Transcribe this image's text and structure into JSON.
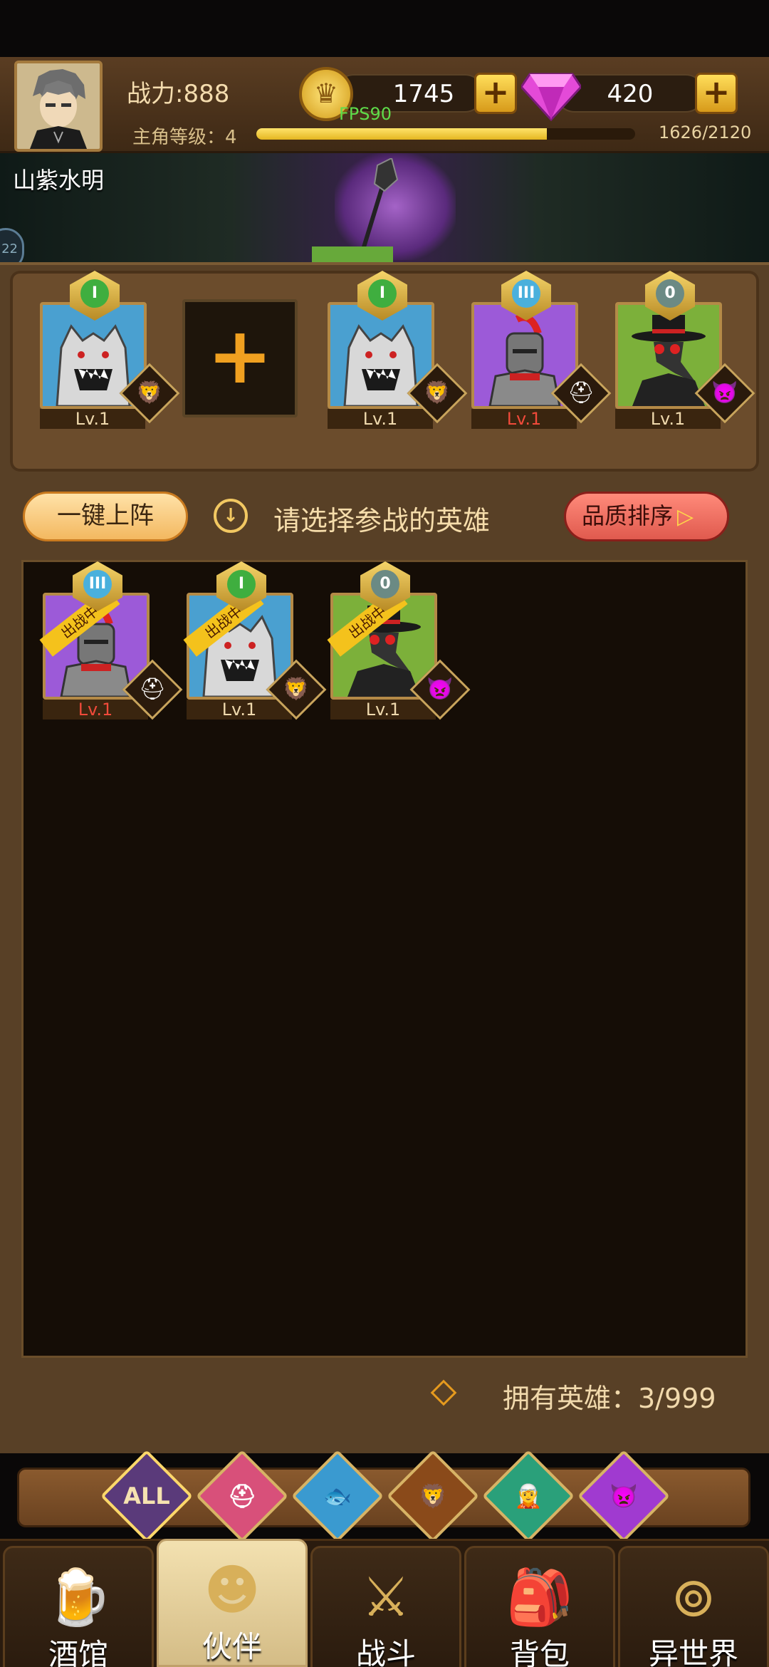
{
  "player": {
    "name": "山紫水明",
    "power": "战力:888",
    "level_label": "主角等级：",
    "level": "4",
    "xp": "1626/2120",
    "xp_fraction": 0.767
  },
  "currency": {
    "gold": "1745",
    "gems": "420",
    "gold_plus": "+",
    "gem_plus": "+"
  },
  "debug": {
    "fps": "FPS90"
  },
  "side_badge": "22",
  "team": {
    "slots": [
      {
        "rank": "I",
        "rank_color": "green",
        "portrait": "wolf",
        "frame": "blue",
        "race": "lion",
        "level": "Lv.1",
        "level_red": false
      },
      {
        "empty": true,
        "add_label": "+"
      },
      {
        "rank": "I",
        "rank_color": "green",
        "portrait": "wolf",
        "frame": "blue",
        "race": "lion",
        "level": "Lv.1",
        "level_red": false
      },
      {
        "rank": "III",
        "rank_color": "blue",
        "portrait": "knight",
        "frame": "purple",
        "race": "helmet",
        "level": "Lv.1",
        "level_red": true
      },
      {
        "rank": "0",
        "rank_color": "gray",
        "portrait": "plague-doctor",
        "frame": "green",
        "race": "demon",
        "level": "Lv.1",
        "level_red": false
      }
    ]
  },
  "controls": {
    "auto_deploy": "一键上阵",
    "instruction": "请选择参战的英雄",
    "sort": "品质排序",
    "sort_arrow": "▷"
  },
  "hero_list": {
    "fighting_tag": "出战中",
    "heroes": [
      {
        "rank": "III",
        "rank_color": "blue",
        "portrait": "knight",
        "frame": "purple",
        "race": "helmet",
        "level": "Lv.1",
        "level_red": true
      },
      {
        "rank": "I",
        "rank_color": "green",
        "portrait": "wolf",
        "frame": "blue",
        "race": "lion",
        "level": "Lv.1",
        "level_red": false
      },
      {
        "rank": "0",
        "rank_color": "gray",
        "portrait": "plague-doctor",
        "frame": "green",
        "race": "demon",
        "level": "Lv.1",
        "level_red": false
      }
    ],
    "owned": "拥有英雄：3/999"
  },
  "filters": [
    {
      "label": "ALL",
      "icon": "all-icon",
      "color": "#5a3a7a"
    },
    {
      "label": "",
      "icon": "helmet-icon",
      "color": "#d8507a"
    },
    {
      "label": "",
      "icon": "fish-icon",
      "color": "#3a9ad0"
    },
    {
      "label": "",
      "icon": "lion-icon",
      "color": "#8a4a1a"
    },
    {
      "label": "",
      "icon": "elf-icon",
      "color": "#2aa07a"
    },
    {
      "label": "",
      "icon": "demon-icon",
      "color": "#a03ad0"
    }
  ],
  "nav": [
    {
      "label": "酒馆",
      "icon": "beer-icon",
      "active": false
    },
    {
      "label": "伙伴",
      "icon": "companion-icon",
      "active": true
    },
    {
      "label": "战斗",
      "icon": "swords-icon",
      "active": false
    },
    {
      "label": "背包",
      "icon": "backpack-icon",
      "active": false
    },
    {
      "label": "异世界",
      "icon": "portal-icon",
      "active": false
    }
  ]
}
